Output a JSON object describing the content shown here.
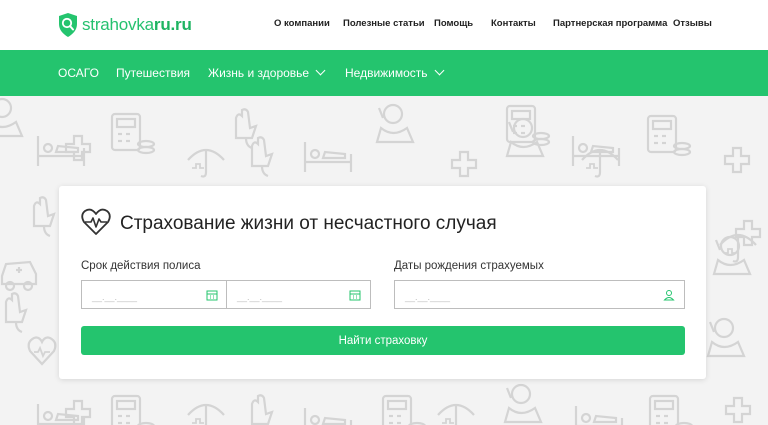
{
  "logo": {
    "text_light": "strahovka",
    "text_bold": "ru.ru"
  },
  "topnav": {
    "items": [
      "О компании",
      "Полезные статьи",
      "Помощь",
      "Контакты",
      "Партнерская программа",
      "Отзывы"
    ]
  },
  "mainnav": {
    "items": [
      {
        "label": "ОСАГО",
        "dropdown": false
      },
      {
        "label": "Путешествия",
        "dropdown": false
      },
      {
        "label": "Жизнь и здоровье",
        "dropdown": true
      },
      {
        "label": "Недвижимость",
        "dropdown": true
      }
    ]
  },
  "form": {
    "title": "Страхование жизни от несчастного случая",
    "period_label": "Срок действия полиса",
    "period_from_placeholder": "__.__.____",
    "period_to_placeholder": "__.__.____",
    "birthdates_label": "Даты рождения страхуемых",
    "birthdates_placeholder": "__.__.____",
    "submit_label": "Найти страховку"
  },
  "colors": {
    "accent": "#24c46e",
    "pattern": "#d6d6d6"
  },
  "icons": [
    "shield-logo-icon",
    "heart-pulse-icon",
    "calendar-icon",
    "user-icon",
    "chevron-down-icon"
  ]
}
